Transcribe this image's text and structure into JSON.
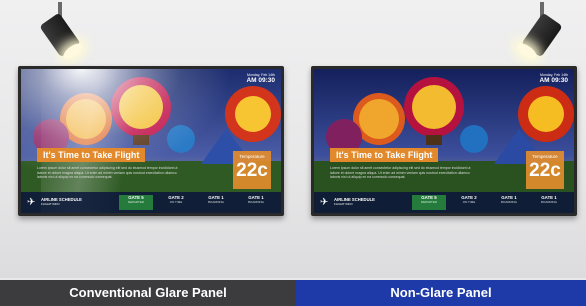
{
  "panels": [
    {
      "clock_date": "Monday, Feb 14th",
      "clock_time": "AM 09:30",
      "headline": "It's Time to Take Flight",
      "body": "Lorem ipsum dolor sit amet consectetur adipiscing elit sed do eiusmod tempor incididunt ut labore et dolore magna aliqua. Ut enim ad minim veniam quis nostrud exercitation ullamco laboris nisi ut aliquip ex ea commodo consequat.",
      "temp_label": "Temperature",
      "temp_value": "22c",
      "schedule_title": "AIRLINE SCHEDULE",
      "schedule_sub": "FLIGHT INFO",
      "gates": [
        {
          "name": "GATE 5",
          "sub": "DEPARTED"
        },
        {
          "name": "GATE 2",
          "sub": "ON TIME"
        },
        {
          "name": "GATE 1",
          "sub": "BOARDING"
        },
        {
          "name": "GATE 1",
          "sub": "BOARDING"
        }
      ],
      "caption": "Conventional Glare Panel"
    },
    {
      "clock_date": "Monday, Feb 14th",
      "clock_time": "AM 09:30",
      "headline": "It's Time to Take Flight",
      "body": "Lorem ipsum dolor sit amet consectetur adipiscing elit sed do eiusmod tempor incididunt ut labore et dolore magna aliqua. Ut enim ad minim veniam quis nostrud exercitation ullamco laboris nisi ut aliquip ex ea commodo consequat.",
      "temp_label": "Temperature",
      "temp_value": "22c",
      "schedule_title": "AIRLINE SCHEDULE",
      "schedule_sub": "FLIGHT INFO",
      "gates": [
        {
          "name": "GATE 5",
          "sub": "DEPARTED"
        },
        {
          "name": "GATE 2",
          "sub": "ON TIME"
        },
        {
          "name": "GATE 1",
          "sub": "BOARDING"
        },
        {
          "name": "GATE 1",
          "sub": "BOARDING"
        }
      ],
      "caption": "Non-Glare Panel"
    }
  ],
  "colors": {
    "left_caption_bg": "#3c3c3e",
    "right_caption_bg": "#1e3aa8",
    "accent_orange": "#e2892b",
    "gate_highlight": "#2a8c3c"
  },
  "icons": [
    "spotlight-icon",
    "airplane-icon"
  ]
}
